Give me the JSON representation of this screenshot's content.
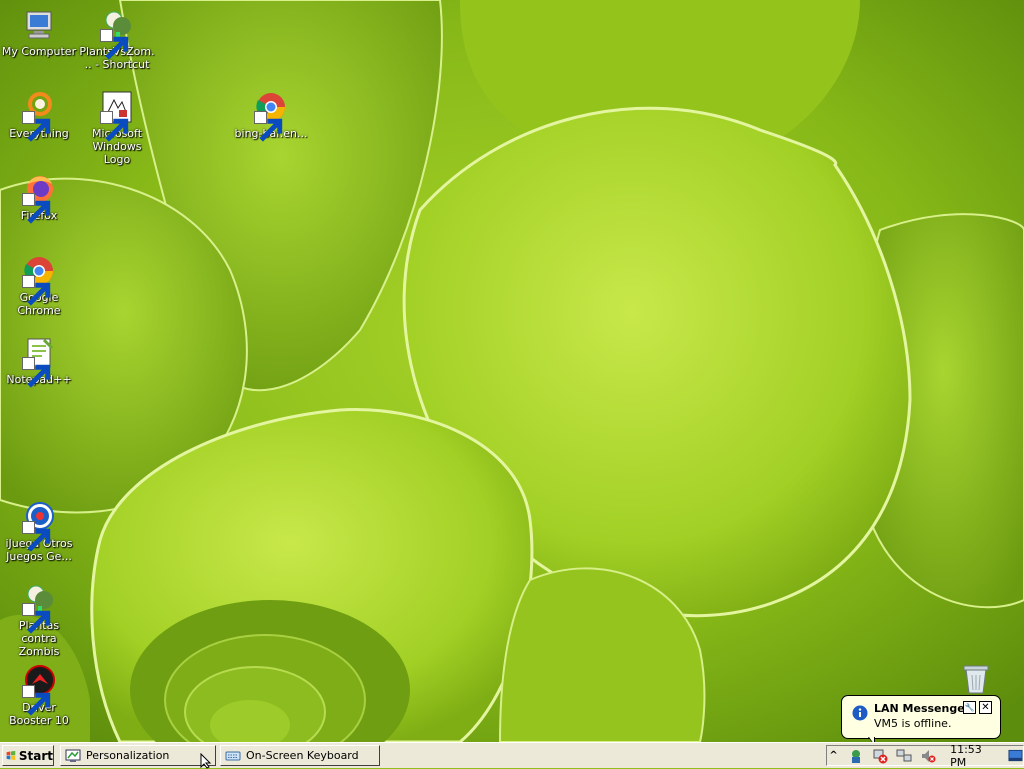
{
  "desktop": {
    "icons": [
      {
        "label": "My Computer",
        "icon": "computer-icon"
      },
      {
        "label": "PlantsVsZom... - Shortcut",
        "icon": "plants-vs-zombies-icon"
      },
      {
        "label": "Everything",
        "icon": "everything-search-icon"
      },
      {
        "label": "Microsoft Windows Logo",
        "icon": "windows-logo-icon"
      },
      {
        "label": "bing-bar.en...",
        "icon": "chrome-icon"
      },
      {
        "label": "Firefox",
        "icon": "firefox-icon"
      },
      {
        "label": "Google Chrome",
        "icon": "chrome-icon"
      },
      {
        "label": "Notepad++",
        "icon": "notepad-plus-plus-icon"
      },
      {
        "label": "iJuega Otros Juegos Ge...",
        "icon": "popcap-games-icon"
      },
      {
        "label": "Plantas contra Zombis",
        "icon": "plants-vs-zombies-icon"
      },
      {
        "label": "Driver Booster 10",
        "icon": "driver-booster-icon"
      }
    ],
    "recycle_bin_icon": "recycle-bin-icon"
  },
  "taskbar": {
    "start_label": "Start",
    "tasks": [
      {
        "label": "Personalization",
        "icon": "personalization-icon"
      },
      {
        "label": "On-Screen Keyboard",
        "icon": "keyboard-icon"
      }
    ],
    "tray": {
      "expand_label": "^",
      "icons": [
        "lan-messenger-icon",
        "network-error-icon",
        "network-icon",
        "volume-muted-icon"
      ],
      "clock": "11:53 PM"
    }
  },
  "balloon": {
    "title": "LAN Messenger",
    "text": "VM5 is offline.",
    "options_label": "🔧",
    "close_label": "✕"
  },
  "colors": {
    "taskbar": "#ece9d8",
    "balloon_bg": "#ffffe1",
    "wallpaper_green": "#8fbf1a"
  }
}
